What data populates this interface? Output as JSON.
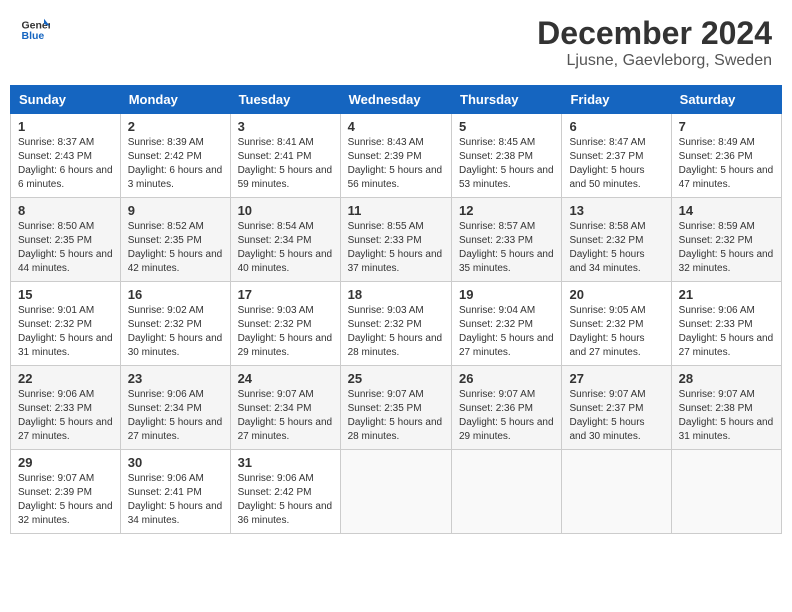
{
  "header": {
    "logo_line1": "General",
    "logo_line2": "Blue",
    "month_title": "December 2024",
    "location": "Ljusne, Gaevleborg, Sweden"
  },
  "weekdays": [
    "Sunday",
    "Monday",
    "Tuesday",
    "Wednesday",
    "Thursday",
    "Friday",
    "Saturday"
  ],
  "weeks": [
    [
      {
        "day": "1",
        "sunrise": "8:37 AM",
        "sunset": "2:43 PM",
        "daylight": "6 hours and 6 minutes."
      },
      {
        "day": "2",
        "sunrise": "8:39 AM",
        "sunset": "2:42 PM",
        "daylight": "6 hours and 3 minutes."
      },
      {
        "day": "3",
        "sunrise": "8:41 AM",
        "sunset": "2:41 PM",
        "daylight": "5 hours and 59 minutes."
      },
      {
        "day": "4",
        "sunrise": "8:43 AM",
        "sunset": "2:39 PM",
        "daylight": "5 hours and 56 minutes."
      },
      {
        "day": "5",
        "sunrise": "8:45 AM",
        "sunset": "2:38 PM",
        "daylight": "5 hours and 53 minutes."
      },
      {
        "day": "6",
        "sunrise": "8:47 AM",
        "sunset": "2:37 PM",
        "daylight": "5 hours and 50 minutes."
      },
      {
        "day": "7",
        "sunrise": "8:49 AM",
        "sunset": "2:36 PM",
        "daylight": "5 hours and 47 minutes."
      }
    ],
    [
      {
        "day": "8",
        "sunrise": "8:50 AM",
        "sunset": "2:35 PM",
        "daylight": "5 hours and 44 minutes."
      },
      {
        "day": "9",
        "sunrise": "8:52 AM",
        "sunset": "2:35 PM",
        "daylight": "5 hours and 42 minutes."
      },
      {
        "day": "10",
        "sunrise": "8:54 AM",
        "sunset": "2:34 PM",
        "daylight": "5 hours and 40 minutes."
      },
      {
        "day": "11",
        "sunrise": "8:55 AM",
        "sunset": "2:33 PM",
        "daylight": "5 hours and 37 minutes."
      },
      {
        "day": "12",
        "sunrise": "8:57 AM",
        "sunset": "2:33 PM",
        "daylight": "5 hours and 35 minutes."
      },
      {
        "day": "13",
        "sunrise": "8:58 AM",
        "sunset": "2:32 PM",
        "daylight": "5 hours and 34 minutes."
      },
      {
        "day": "14",
        "sunrise": "8:59 AM",
        "sunset": "2:32 PM",
        "daylight": "5 hours and 32 minutes."
      }
    ],
    [
      {
        "day": "15",
        "sunrise": "9:01 AM",
        "sunset": "2:32 PM",
        "daylight": "5 hours and 31 minutes."
      },
      {
        "day": "16",
        "sunrise": "9:02 AM",
        "sunset": "2:32 PM",
        "daylight": "5 hours and 30 minutes."
      },
      {
        "day": "17",
        "sunrise": "9:03 AM",
        "sunset": "2:32 PM",
        "daylight": "5 hours and 29 minutes."
      },
      {
        "day": "18",
        "sunrise": "9:03 AM",
        "sunset": "2:32 PM",
        "daylight": "5 hours and 28 minutes."
      },
      {
        "day": "19",
        "sunrise": "9:04 AM",
        "sunset": "2:32 PM",
        "daylight": "5 hours and 27 minutes."
      },
      {
        "day": "20",
        "sunrise": "9:05 AM",
        "sunset": "2:32 PM",
        "daylight": "5 hours and 27 minutes."
      },
      {
        "day": "21",
        "sunrise": "9:06 AM",
        "sunset": "2:33 PM",
        "daylight": "5 hours and 27 minutes."
      }
    ],
    [
      {
        "day": "22",
        "sunrise": "9:06 AM",
        "sunset": "2:33 PM",
        "daylight": "5 hours and 27 minutes."
      },
      {
        "day": "23",
        "sunrise": "9:06 AM",
        "sunset": "2:34 PM",
        "daylight": "5 hours and 27 minutes."
      },
      {
        "day": "24",
        "sunrise": "9:07 AM",
        "sunset": "2:34 PM",
        "daylight": "5 hours and 27 minutes."
      },
      {
        "day": "25",
        "sunrise": "9:07 AM",
        "sunset": "2:35 PM",
        "daylight": "5 hours and 28 minutes."
      },
      {
        "day": "26",
        "sunrise": "9:07 AM",
        "sunset": "2:36 PM",
        "daylight": "5 hours and 29 minutes."
      },
      {
        "day": "27",
        "sunrise": "9:07 AM",
        "sunset": "2:37 PM",
        "daylight": "5 hours and 30 minutes."
      },
      {
        "day": "28",
        "sunrise": "9:07 AM",
        "sunset": "2:38 PM",
        "daylight": "5 hours and 31 minutes."
      }
    ],
    [
      {
        "day": "29",
        "sunrise": "9:07 AM",
        "sunset": "2:39 PM",
        "daylight": "5 hours and 32 minutes."
      },
      {
        "day": "30",
        "sunrise": "9:06 AM",
        "sunset": "2:41 PM",
        "daylight": "5 hours and 34 minutes."
      },
      {
        "day": "31",
        "sunrise": "9:06 AM",
        "sunset": "2:42 PM",
        "daylight": "5 hours and 36 minutes."
      },
      null,
      null,
      null,
      null
    ]
  ]
}
